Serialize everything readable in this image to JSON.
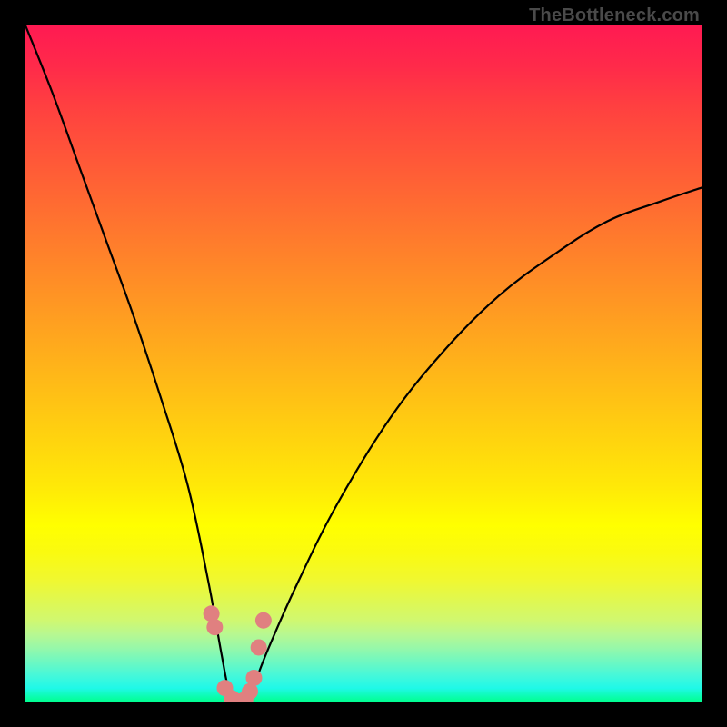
{
  "attribution": "TheBottleneck.com",
  "colors": {
    "frame": "#000000",
    "curve": "#000000",
    "marker": "#e08080",
    "gradient_top": "#ff1a52",
    "gradient_mid": "#ffff00",
    "gradient_bottom": "#00ff90"
  },
  "chart_data": {
    "type": "line",
    "title": "",
    "xlabel": "",
    "ylabel": "",
    "x_range": [
      0,
      100
    ],
    "y_range_percent_bottleneck": [
      0,
      100
    ],
    "note": "Bottleneck-style V-curve. Minimum (optimal match) around x≈31 where y≈0. Color gradient maps bottleneck severity: red=high, green=low. No axis tick labels visible.",
    "series": [
      {
        "name": "bottleneck-curve",
        "x": [
          0,
          4,
          8,
          12,
          16,
          20,
          24,
          27,
          29,
          30,
          31,
          32,
          33,
          34,
          36,
          40,
          46,
          54,
          62,
          70,
          78,
          86,
          94,
          100
        ],
        "y": [
          100,
          90,
          79,
          68,
          57,
          45,
          32,
          18,
          7,
          2,
          0,
          0,
          1,
          3,
          8,
          17,
          29,
          42,
          52,
          60,
          66,
          71,
          74,
          76
        ]
      }
    ],
    "markers": {
      "name": "highlight-points",
      "x": [
        27.5,
        28.0,
        29.5,
        30.5,
        31.5,
        32.5,
        33.2,
        33.8,
        34.5,
        35.2
      ],
      "y": [
        13.0,
        11.0,
        2.0,
        0.5,
        0.0,
        0.3,
        1.5,
        3.5,
        8.0,
        12.0
      ]
    }
  }
}
